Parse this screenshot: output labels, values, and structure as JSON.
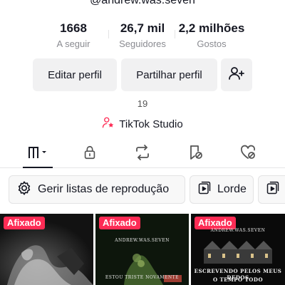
{
  "profile": {
    "username": "@andrew.was.seven",
    "stats": {
      "following": {
        "value": "1668",
        "label": "A seguir"
      },
      "followers": {
        "value": "26,7 mil",
        "label": "Seguidores"
      },
      "likes": {
        "value": "2,2 milhões",
        "label": "Gostos"
      }
    },
    "buttons": {
      "edit": "Editar perfil",
      "share": "Partilhar perfil",
      "add_friends_icon": "add-person-icon"
    },
    "count": "19",
    "studio_label": "TikTok Studio"
  },
  "tabs": [
    {
      "icon": "videos-grid-icon",
      "active": true
    },
    {
      "icon": "lock-icon",
      "active": false
    },
    {
      "icon": "repost-icon",
      "active": false
    },
    {
      "icon": "bookmark-icon",
      "active": false
    },
    {
      "icon": "liked-heart-icon",
      "active": false
    }
  ],
  "chips": {
    "playlists": "Gerir listas de reprodução",
    "lorde": "Lorde"
  },
  "videos": [
    {
      "badge": "Afixado",
      "overlay": ""
    },
    {
      "badge": "Afixado",
      "overlay": "ESTOU TRISTE NOVAMENTE",
      "caption_top": "ANDREW.WAS.SEVEN"
    },
    {
      "badge": "Afixado",
      "overlay_line1": "ESCREVENDO PELOS MEUS DEDOS",
      "overlay_line2": "O TEMPO TODO",
      "caption_top": "ANDREW.WAS.SEVEN"
    }
  ],
  "colors": {
    "accent": "#fe2c55",
    "text": "#161823",
    "muted": "#8a8b91",
    "button_bg": "#f1f1f2"
  }
}
